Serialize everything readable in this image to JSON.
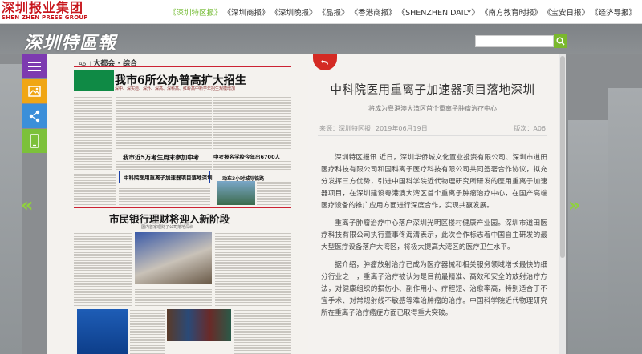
{
  "logo": {
    "cn": "深圳报业集团",
    "en": "SHEN ZHEN PRESS GROUP"
  },
  "nav": [
    "《深圳特区报》",
    "《深圳商报》",
    "《深圳晚报》",
    "《晶报》",
    "《香港商报》",
    "《SHENZHEN DAILY》",
    "《南方教育时报》",
    "《宝安日报》",
    "《经济导报》"
  ],
  "brand": "深圳特區報",
  "search": {
    "placeholder": ""
  },
  "icons": {
    "menu": "menu-icon",
    "photo": "image-icon",
    "share": "share-icon",
    "mobile": "mobile-icon",
    "prev": "chevron-left-double-icon",
    "next": "chevron-right-double-icon",
    "back": "back-arrow-icon",
    "search": "search-icon"
  },
  "colors": {
    "accent": "#7ab82d",
    "brand_red": "#c8161d",
    "back_red": "#d42a24"
  },
  "arrows": {
    "prev": "«",
    "next": "»"
  },
  "paper": {
    "page": "A6",
    "section": "大都会 · 综合",
    "headline_main": "我市6所公办普高扩大招生",
    "headline_sub": "深中、深实验、深外、深高、深科高、红岭高中新学年招生规模增加",
    "headline_2": "我市近5万考生周末参加中考",
    "headline_3": "中考报名学校今年出6700人",
    "headline_4": "中科院医用重离子加速器项目落地深圳",
    "headline_5": "动车3小时城际铁路",
    "headline_6": "市民银行理财将迎入新阶段",
    "headline_6_sub": "国内首家理财子公司落地深圳"
  },
  "article": {
    "title": "中科院医用重离子加速器项目落地深圳",
    "subtitle": "将成为粤港澳大湾区首个重离子肿瘤治疗中心",
    "source": "来源：深圳特区报",
    "date": "2019年06月19日",
    "edition": "版次：A06",
    "paragraphs": [
      "深圳特区报讯 近日，深圳华侨城文化置业投资有限公司、深圳市道田医疗科技有限公司和国科离子医疗科技有限公司共同签署合作协议，拟充分发挥三方优势，引进中国科学院近代物理研究所研发的医用重离子加速器项目，在深圳建设粤港澳大湾区首个重离子肿瘤治疗中心，在国产高端医疗设备的推广应用方面进行深度合作，实现共赢发展。",
      "重离子肿瘤治疗中心落户深圳光明区楼村健康产业园。深圳市道田医疗科技有限公司执行董事佟海清表示，此次合作标志着中国自主研发的最大型医疗设备落户大湾区，将极大提高大湾区的医疗卫生水平。",
      "据介绍，肿瘤放射治疗已成为医疗器械和相关服务领域增长最快的细分行业之一，重离子治疗被认为是目前最精准、高效和安全的放射治疗方法，对健康组织的损伤小、副作用小、疗程短、治愈率高，特别适合于不宜手术、对常规射线不敏感等难治肿瘤的治疗。中国科学院近代物理研究所在重离子治疗癌症方面已取得重大突破。"
    ]
  }
}
